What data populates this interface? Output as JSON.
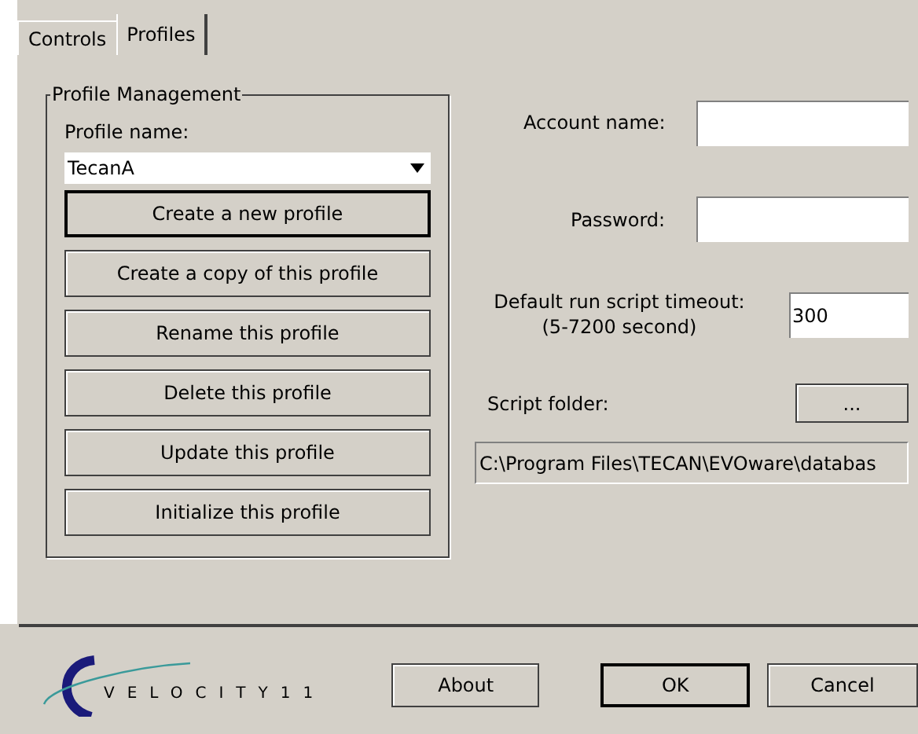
{
  "tabs": [
    {
      "label": "Controls",
      "selected": false
    },
    {
      "label": "Profiles",
      "selected": true
    }
  ],
  "profile_management": {
    "title": "Profile Management",
    "profile_name_label": "Profile name:",
    "profile_name_value": "TecanA",
    "buttons": [
      {
        "label": "Create a new profile",
        "focused": true
      },
      {
        "label": "Create a copy of this profile",
        "focused": false
      },
      {
        "label": "Rename this profile",
        "focused": false
      },
      {
        "label": "Delete this profile",
        "focused": false
      },
      {
        "label": "Update this profile",
        "focused": false
      },
      {
        "label": "Initialize this profile",
        "focused": false
      }
    ]
  },
  "account_name": {
    "label": "Account name:"
  },
  "password": {
    "label": "Password:"
  },
  "timeout": {
    "label": "Default run script timeout:",
    "sublabel": "(5-7200 second)",
    "value": "300"
  },
  "script_folder": {
    "label": "Script folder:",
    "browse_button": "...",
    "path": "C:\\Program Files\\TECAN\\EVOware\\databas"
  },
  "logo": {
    "text": "VELOCITY11"
  },
  "footer_buttons": [
    {
      "label": "About",
      "default": false
    },
    {
      "label": "OK",
      "default": true
    },
    {
      "label": "Cancel",
      "default": false
    }
  ]
}
